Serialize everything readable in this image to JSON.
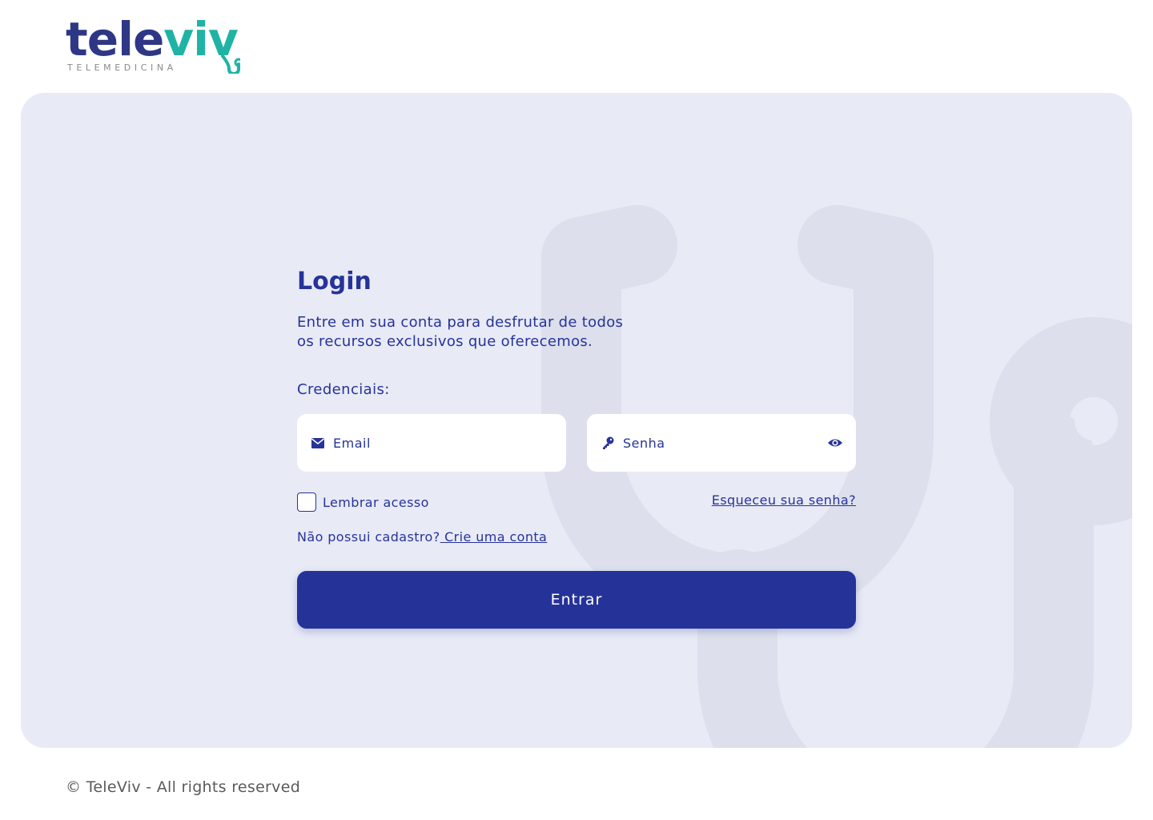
{
  "brand": {
    "name_part1": "tele",
    "name_part2": "viv",
    "tagline": "TELEMEDICINA",
    "primary_color": "#263399",
    "accent_color": "#1fb3a4",
    "card_bg": "#e8eaf6"
  },
  "login": {
    "title": "Login",
    "subtitle_line1": "Entre em sua conta para desfrutar de todos",
    "subtitle_line2": "os recursos exclusivos que oferecemos.",
    "credentials_label": "Credenciais:",
    "email_placeholder": "Email",
    "email_icon": "envelope-icon",
    "password_placeholder": "Senha",
    "password_icon": "key-icon",
    "show_password_icon": "eye-icon",
    "remember_label": "Lembrar acesso",
    "remember_checked": false,
    "forgot_link": "Esqueceu sua senha?",
    "register_text": "Não possui cadastro?",
    "register_link": " Crie uma conta",
    "submit_label": "Entrar"
  },
  "footer": {
    "copyright": "© TeleViv - All rights reserved"
  }
}
